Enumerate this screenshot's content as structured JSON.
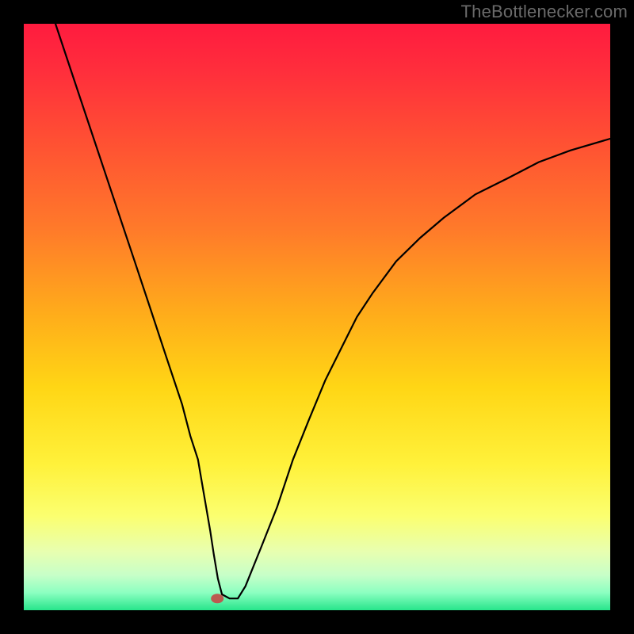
{
  "watermark": "TheBottlenecker.com",
  "chart_data": {
    "type": "line",
    "title": "",
    "xlabel": "",
    "ylabel": "",
    "xlim": [
      0,
      100
    ],
    "ylim": [
      0,
      100
    ],
    "grid": false,
    "legend": false,
    "background_gradient": [
      {
        "offset": 0.0,
        "color": "#ff1b3f"
      },
      {
        "offset": 0.08,
        "color": "#ff2e3c"
      },
      {
        "offset": 0.2,
        "color": "#ff5033"
      },
      {
        "offset": 0.35,
        "color": "#ff7a2a"
      },
      {
        "offset": 0.5,
        "color": "#ffae1a"
      },
      {
        "offset": 0.62,
        "color": "#ffd615"
      },
      {
        "offset": 0.75,
        "color": "#fff13a"
      },
      {
        "offset": 0.84,
        "color": "#fbff70"
      },
      {
        "offset": 0.9,
        "color": "#e8ffb0"
      },
      {
        "offset": 0.94,
        "color": "#c7ffc8"
      },
      {
        "offset": 0.97,
        "color": "#8cffc1"
      },
      {
        "offset": 1.0,
        "color": "#27e58b"
      }
    ],
    "annotations": [
      {
        "type": "marker",
        "x": 33,
        "y": 2,
        "label": "optimal-point",
        "color": "#bb5a50"
      }
    ],
    "series": [
      {
        "name": "bottleneck-curve",
        "x": [
          5.4,
          8.1,
          10.8,
          13.5,
          16.2,
          18.9,
          21.6,
          24.3,
          27.0,
          28.4,
          29.7,
          30.4,
          31.1,
          31.8,
          32.4,
          33.1,
          33.8,
          35.1,
          36.5,
          37.8,
          40.5,
          43.2,
          45.9,
          48.6,
          51.4,
          54.1,
          56.8,
          59.5,
          63.5,
          67.6,
          71.6,
          77.0,
          82.4,
          87.8,
          93.2,
          100.0
        ],
        "y": [
          100.0,
          91.9,
          83.8,
          75.7,
          67.6,
          59.5,
          51.4,
          43.2,
          35.1,
          29.7,
          25.7,
          21.6,
          17.6,
          13.5,
          9.5,
          5.4,
          2.7,
          2.0,
          2.0,
          4.1,
          10.8,
          17.6,
          25.7,
          32.4,
          39.2,
          44.6,
          50.0,
          54.1,
          59.5,
          63.5,
          66.9,
          70.9,
          73.6,
          76.4,
          78.4,
          80.4
        ]
      }
    ]
  }
}
